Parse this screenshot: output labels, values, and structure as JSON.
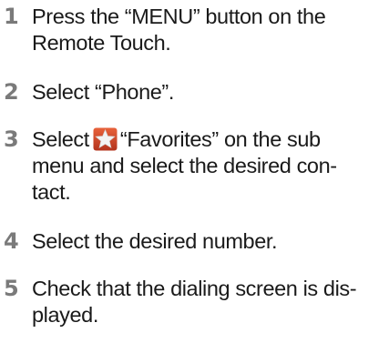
{
  "steps": [
    {
      "number": "1",
      "lines": [
        "Press the “MENU” button on the",
        "Remote Touch."
      ]
    },
    {
      "number": "2",
      "lines": [
        "Select “Phone”."
      ]
    },
    {
      "number": "3",
      "lines_first_before": "Select",
      "lines_first_after": "“Favorites” on the sub",
      "lines": [
        "menu and select the desired con-",
        "tact."
      ],
      "icon": "favorites-star-icon"
    },
    {
      "number": "4",
      "lines": [
        "Select the desired number."
      ]
    },
    {
      "number": "5",
      "lines": [
        "Check that the dialing screen is dis-",
        "played."
      ]
    }
  ]
}
